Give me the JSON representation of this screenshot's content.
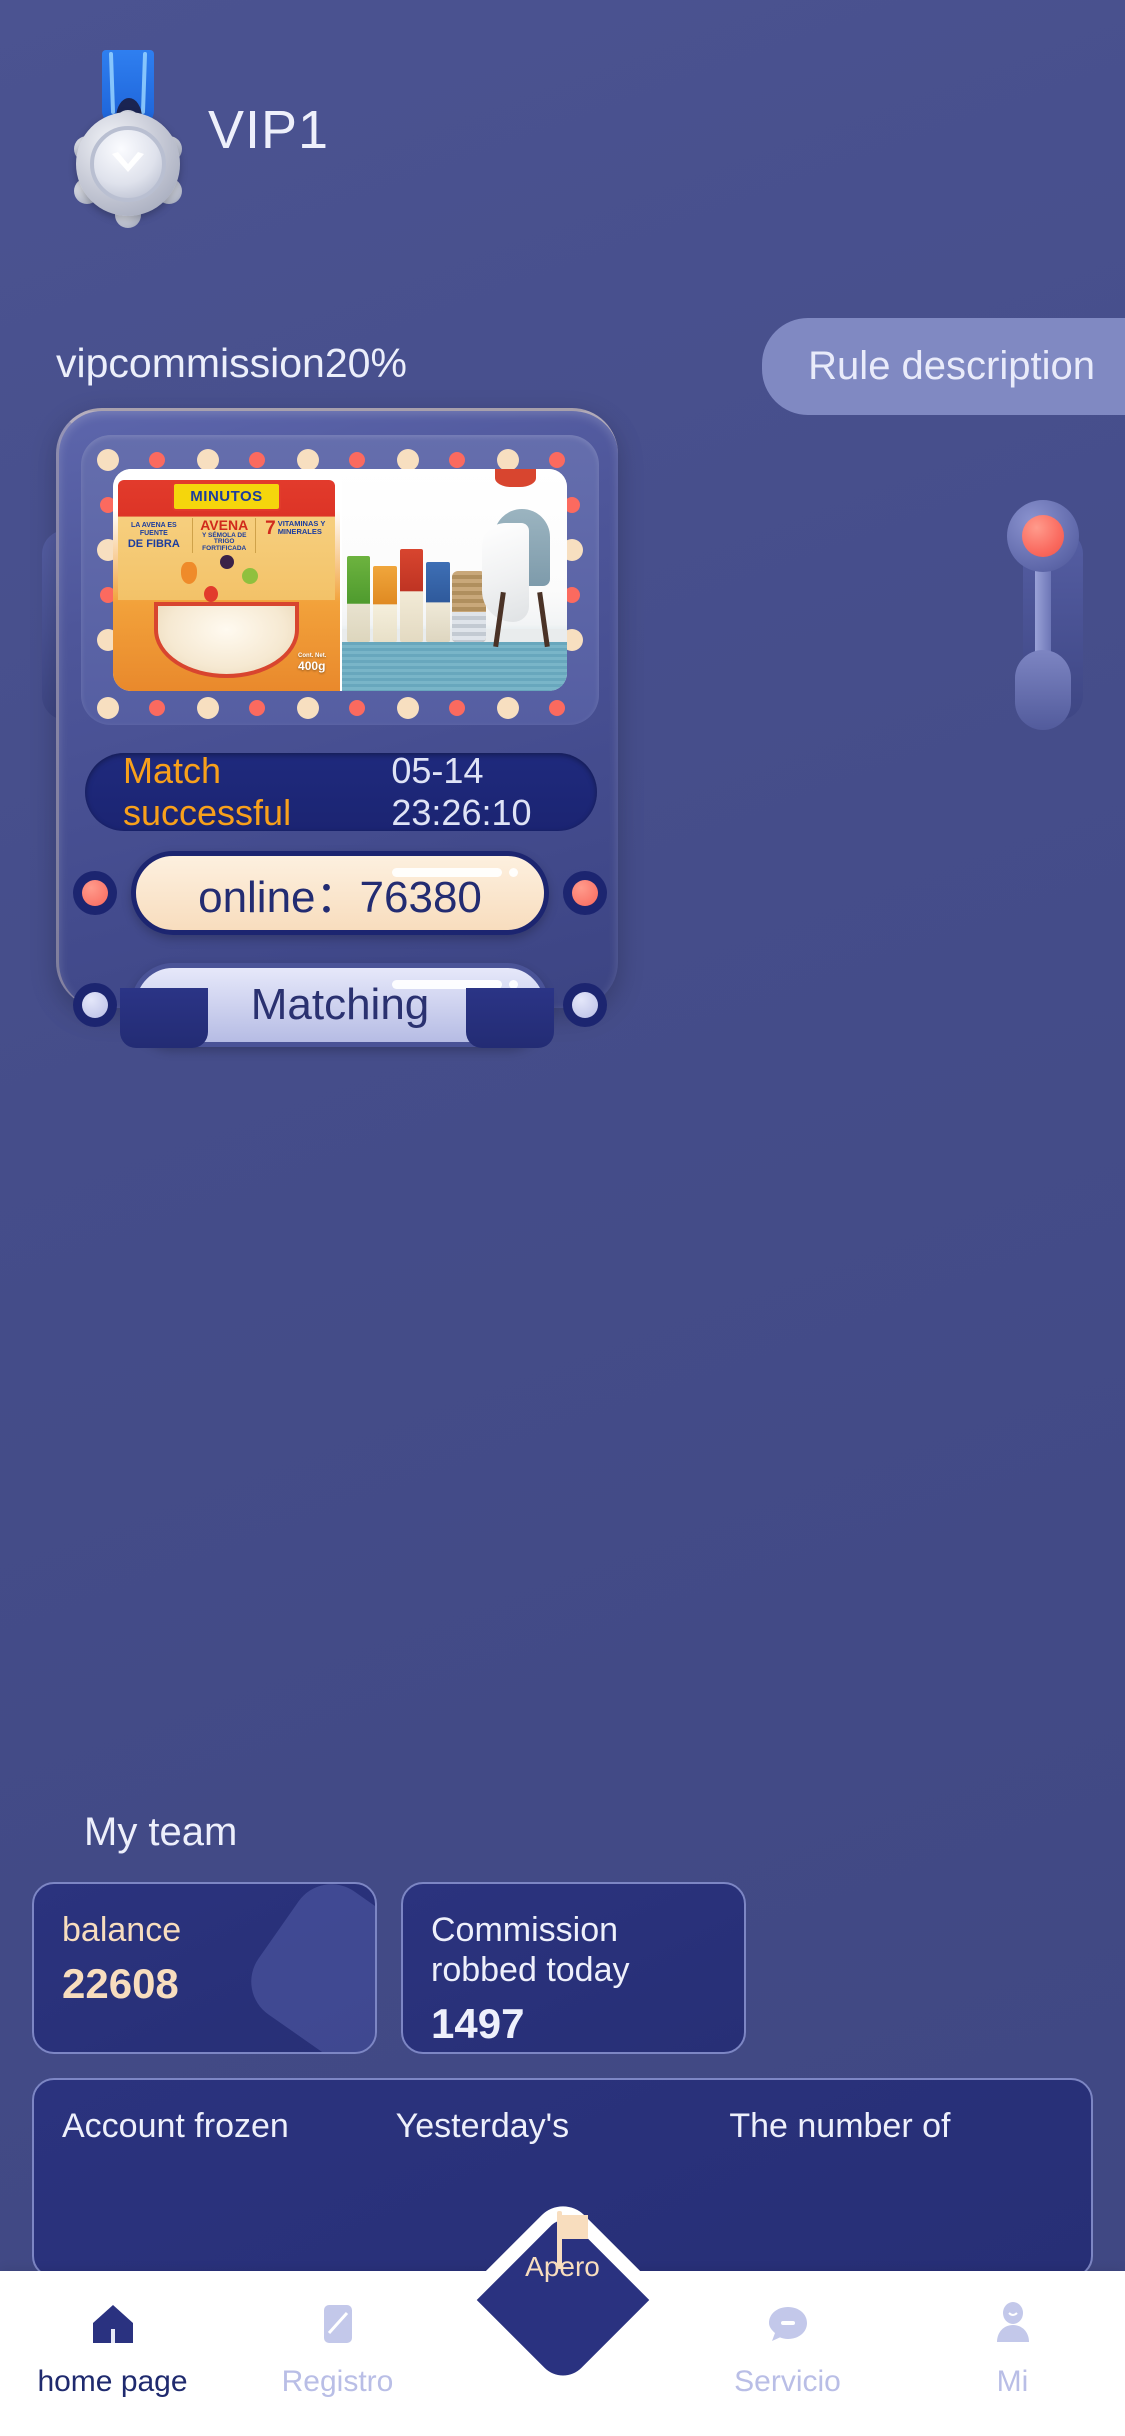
{
  "header": {
    "vip_level": "VIP1",
    "medal_icon": "vip-medal-icon",
    "commission_text": "vipcommission20%",
    "rule_button": "Rule description"
  },
  "machine": {
    "carousel": {
      "slides": [
        {
          "name": "oat-cereal-product",
          "brand": "MINUTOS",
          "left_text_small": "LA AVENA ES FUENTE",
          "left_text_bold": "DE FIBRA",
          "center_text": "AVENA",
          "center_sub": "Y SÉMOLA DE",
          "center_sub2": "TRIGO FORTIFICADA",
          "right_number": "7",
          "right_text": "VITAMINAS Y MINERALES",
          "net_label": "Cont. Net.",
          "net_weight": "400g"
        },
        {
          "name": "home-goods-room-photo"
        }
      ]
    },
    "match_status": "Match successful",
    "match_time": "05-14 23:26:10",
    "online_button": "online：76380",
    "matching_button": "Matching"
  },
  "team": {
    "title": "My team",
    "cards": [
      {
        "label": "balance",
        "value": "22608",
        "style": "cream"
      },
      {
        "label": "Commission robbed today",
        "value": "1497",
        "style": "white"
      }
    ],
    "cards_row2": [
      {
        "label": "Account frozen"
      },
      {
        "label": "Yesterday's"
      },
      {
        "label": "The number of"
      }
    ]
  },
  "tabbar": {
    "items": [
      {
        "label": "home page",
        "icon": "home-icon",
        "active": true
      },
      {
        "label": "Registro",
        "icon": "record-icon",
        "active": false
      },
      {
        "label": "Apero",
        "icon": "flag-icon",
        "active": false,
        "center": true
      },
      {
        "label": "Servicio",
        "icon": "chat-icon",
        "active": false
      },
      {
        "label": "Mi",
        "icon": "user-icon",
        "active": false
      }
    ]
  },
  "colors": {
    "background": "#474f8c",
    "accent_orange": "#f8a01b",
    "accent_cream": "#f8ddbe",
    "accent_red": "#fb6a5f",
    "deep_navy": "#1f2a7d"
  }
}
